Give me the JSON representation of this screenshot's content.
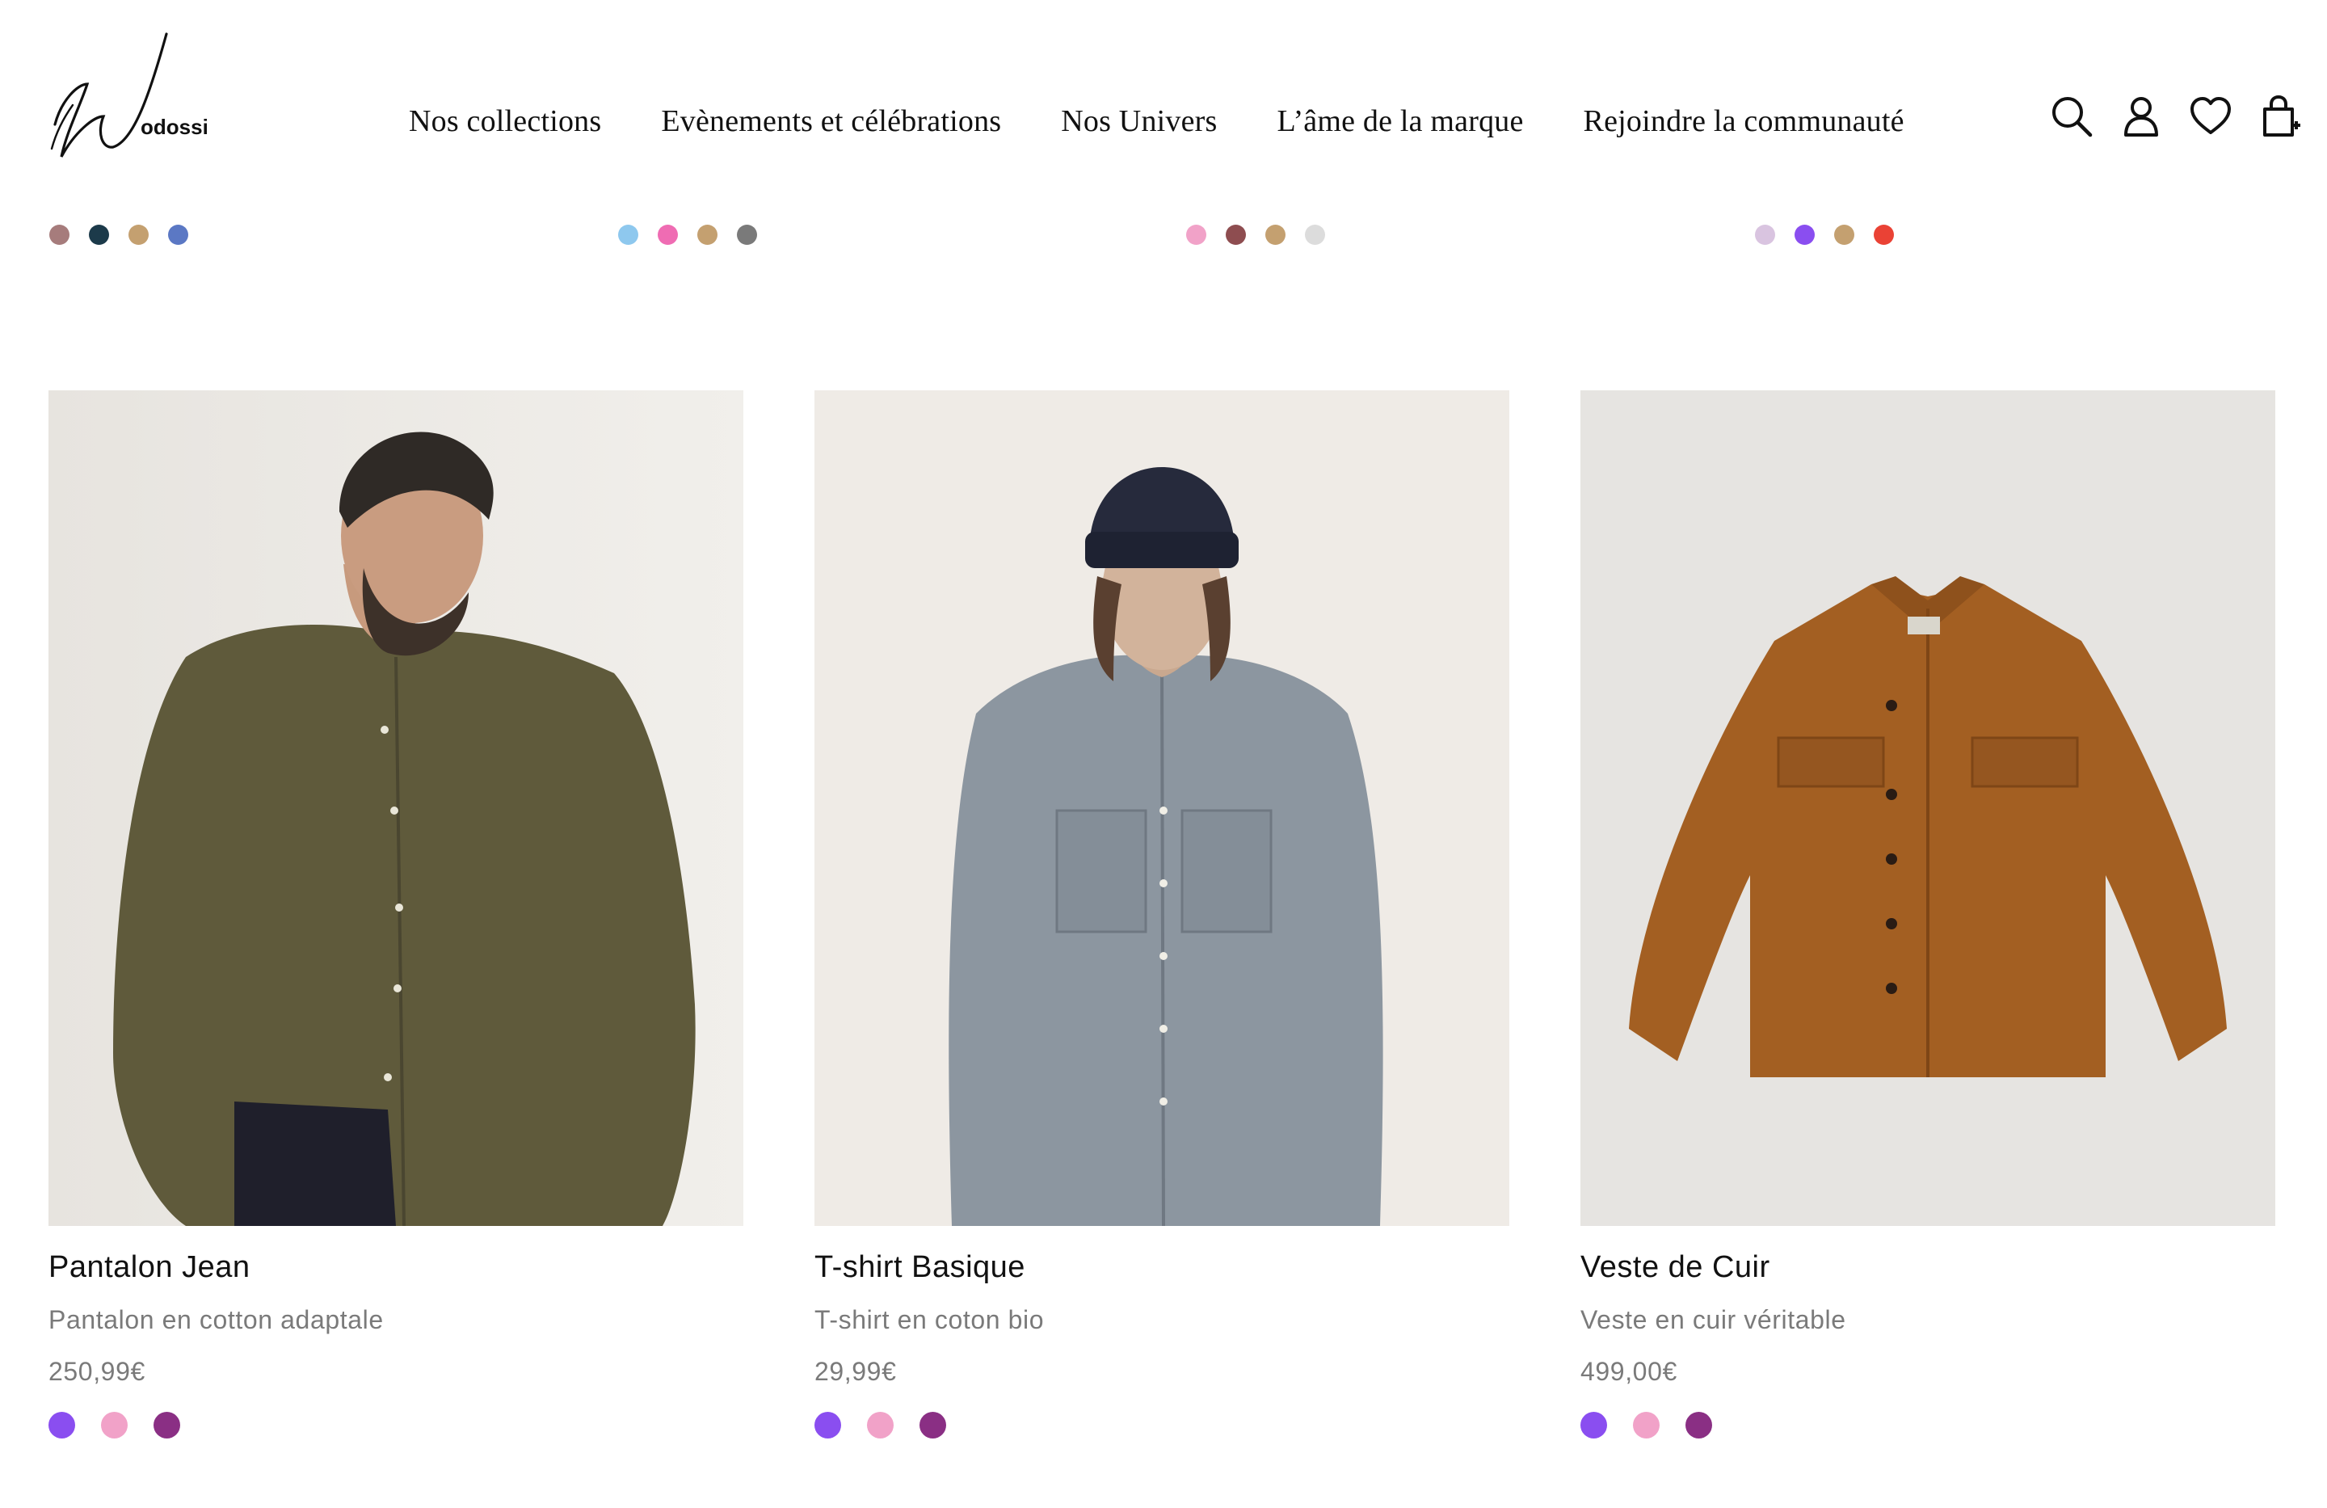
{
  "brand": {
    "logo_text": "Wodossi"
  },
  "nav": {
    "items": [
      {
        "label": "Nos collections"
      },
      {
        "label": "Evènements et célébrations"
      },
      {
        "label": "Nos Univers"
      },
      {
        "label": "L’âme de la marque"
      },
      {
        "label": "Rejoindre la communauté"
      }
    ]
  },
  "header_icons": [
    "search-icon",
    "account-icon",
    "heart-icon",
    "cart-icon"
  ],
  "previous_row_swatches": [
    [
      "#a67c7c",
      "#1c3a4a",
      "#c4a070",
      "#5b78c4"
    ],
    [
      "#8ec8ee",
      "#ef6cb3",
      "#c4a070",
      "#7a7a7a"
    ],
    [
      "#f1a2c8",
      "#8e4d50",
      "#c4a070",
      "#dcdcdc"
    ],
    [
      "#d9c4e0",
      "#8a4ef0",
      "#c4a070",
      "#ea4235"
    ]
  ],
  "products": [
    {
      "name": "Pantalon Jean",
      "description": "Pantalon en cotton adaptale",
      "price": "250,99€",
      "swatches": [
        "#8a4ef0",
        "#f1a2c8",
        "#8a2f84"
      ]
    },
    {
      "name": "T-shirt Basique",
      "description": "T-shirt en coton bio",
      "price": "29,99€",
      "swatches": [
        "#8a4ef0",
        "#f1a2c8",
        "#8a2f84"
      ]
    },
    {
      "name": "Veste de Cuir",
      "description": "Veste en cuir véritable",
      "price": "499,00€",
      "swatches": [
        "#8a4ef0",
        "#f1a2c8",
        "#8a2f84"
      ]
    }
  ]
}
